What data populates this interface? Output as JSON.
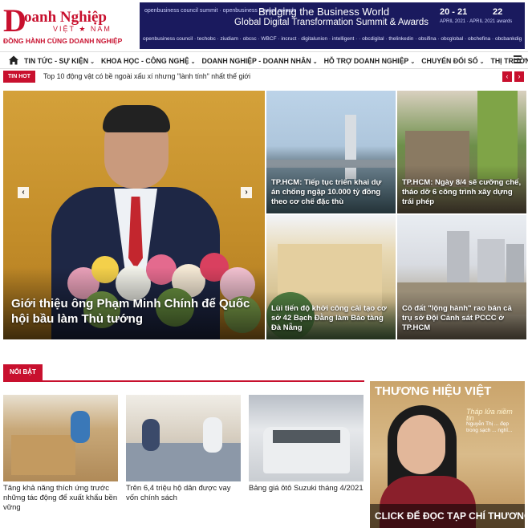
{
  "header": {
    "logo_brand": "oanh Nghiệp",
    "logo_letter": "D",
    "logo_sub": "VIỆT ★ NAM",
    "logo_tagline": "ĐỒNG HÀNH CÙNG DOANH NGHIỆP"
  },
  "banner": {
    "top_left": "openbusiness council summit · openbusiness council awards",
    "headline1": "Bridging the Business World",
    "headline2": "Global Digital Transformation Summit & Awards",
    "date1": "20 - 21",
    "date2": "22",
    "month": "APRIL 2021 · APRIL 2021 awards",
    "sponsors": "openbusiness council · techobc · ziudiam · obcsc · WBCF · incruct · digitalunion · intelligent ·  · obcdigital · thelinkedin · obsifina · obcglobal · obchefina · obcbankdigital · ttradarhia · DoanhNghiep"
  },
  "nav": {
    "items": [
      {
        "label": "TIN TỨC - SỰ KIỆN"
      },
      {
        "label": "KHOA HỌC - CÔNG NGHỆ"
      },
      {
        "label": "DOANH NGHIỆP - DOANH NHÂN"
      },
      {
        "label": "HỖ TRỢ DOANH NGHIỆP"
      },
      {
        "label": "CHUYỂN ĐỔI SỐ"
      },
      {
        "label": "THỊ TRƯỜNG"
      }
    ],
    "caret": "⌄"
  },
  "ticker": {
    "badge": "TIN HOT",
    "text": "Top 10 động vật có bề ngoài xấu xí nhưng \"lành tính\" nhất thế giới",
    "prev": "‹",
    "next": "›"
  },
  "hero": {
    "title": "Giới thiệu ông Phạm Minh Chính để Quốc hội bầu làm Thủ tướng",
    "prev": "‹",
    "next": "›"
  },
  "grid": [
    {
      "title": "TP.HCM: Tiếp tục triển khai dự án chống ngập 10.000 tỷ đồng theo cơ chế đặc thù"
    },
    {
      "title": "TP.HCM: Ngày 8/4 sẽ cưỡng chế, tháo dỡ 6 công trình xây dựng trái phép"
    },
    {
      "title": "Lùi tiến độ khởi công cải tạo cơ sở 42 Bạch Đằng làm Bảo tàng Đà Nẵng"
    },
    {
      "title": "Cô đất \"lộng hành\" rao bán cả trụ sở Đội Cảnh sát PCCC ở TP.HCM"
    }
  ],
  "section": {
    "label": "NỔI BẬT"
  },
  "news": [
    {
      "title": "Tăng khả năng thích ứng trước những tác động để xuất khẩu bền vững"
    },
    {
      "title": "Trên 6,4 triệu hộ dân được vay vốn chính sách"
    },
    {
      "title": "Bảng giá ôtô Suzuki tháng 4/2021"
    }
  ],
  "magazine": {
    "masthead": "THƯƠNG HIỆU VIỆT",
    "side_big": "Tháp lửa niềm tin",
    "side_text": "Nguyễn Thị ... đẹp trong sạch ... nghĩ...",
    "cta": "CLICK ĐỂ ĐỌC TẠP CHÍ THƯƠNG HIỆU VIỆT"
  },
  "colors": {
    "accent": "#c8102e",
    "banner": "#1a1a5e"
  }
}
